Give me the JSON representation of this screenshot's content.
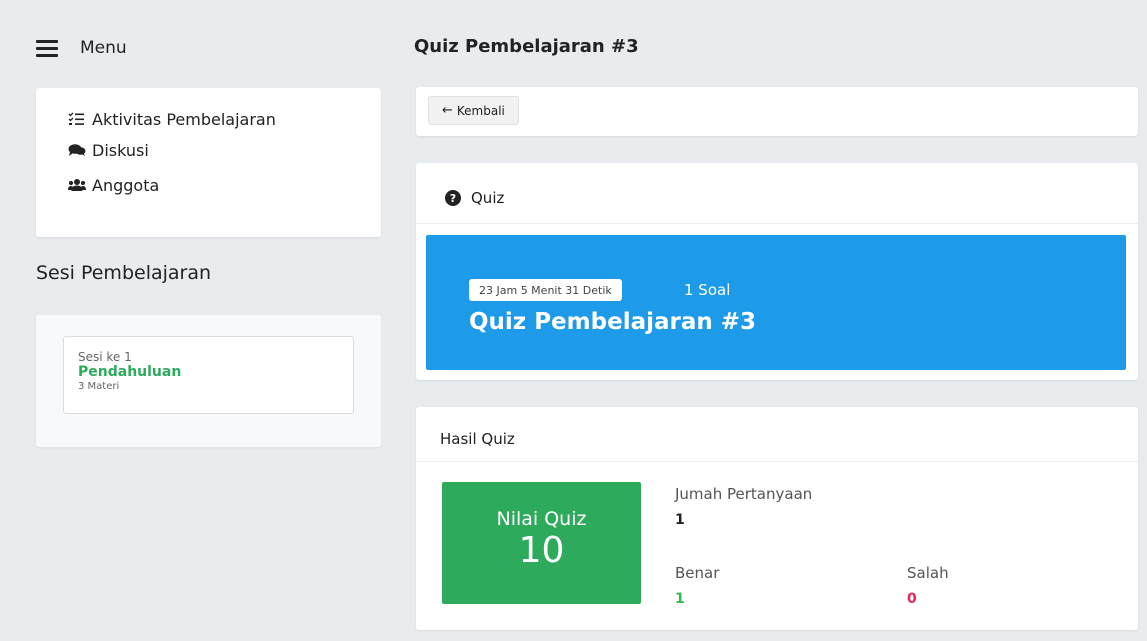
{
  "sidebar": {
    "menu_label": "Menu",
    "nav": [
      {
        "label": "Aktivitas Pembelajaran",
        "icon": "list-check-icon"
      },
      {
        "label": "Diskusi",
        "icon": "comments-icon"
      },
      {
        "label": "Anggota",
        "icon": "users-icon"
      }
    ],
    "sesi_title": "Sesi Pembelajaran",
    "sesi": {
      "number": "Sesi ke 1",
      "name": "Pendahuluan",
      "materi": "3 Materi"
    }
  },
  "main": {
    "page_title": "Quiz Pembelajaran #3",
    "back_label": "Kembali",
    "quiz_section_label": "Quiz",
    "banner": {
      "timer": "23 Jam 5 Menit 31 Detik",
      "soal": "1 Soal",
      "title": "Quiz Pembelajaran #3"
    },
    "hasil": {
      "title": "Hasil Quiz",
      "nilai_label": "Nilai Quiz",
      "nilai_value": "10",
      "jumlah_label": "Jumah Pertanyaan",
      "jumlah_value": "1",
      "benar_label": "Benar",
      "benar_value": "1",
      "salah_label": "Salah",
      "salah_value": "0"
    }
  },
  "colors": {
    "banner": "#1e9be8",
    "nilai_box": "#2eaa5d",
    "benar": "#2dbd4f",
    "salah": "#e8245b",
    "sesi_name": "#2dab5d"
  }
}
